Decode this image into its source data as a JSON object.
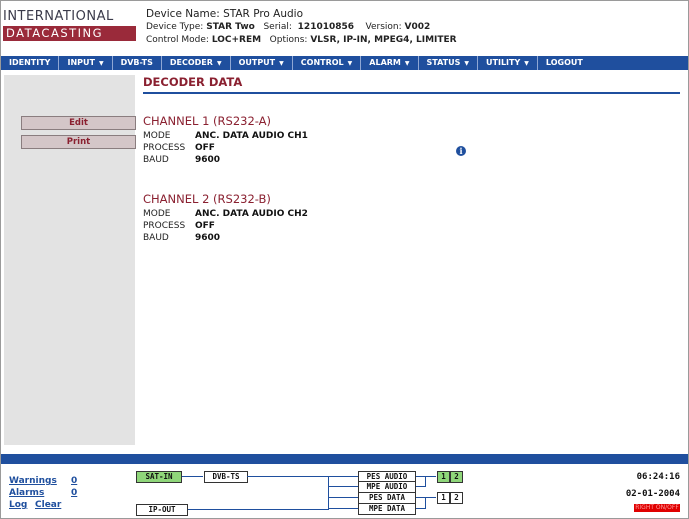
{
  "logo": {
    "line1": "INTERNATIONAL",
    "line2": "DATACASTING"
  },
  "device": {
    "name_label": "Device Name:",
    "name": "STAR Pro Audio",
    "type_label": "Device Type:",
    "type": "STAR Two",
    "serial_label": "Serial:",
    "serial": "121010856",
    "version_label": "Version:",
    "version": "V002",
    "control_label": "Control Mode:",
    "control": "LOC+REM",
    "options_label": "Options:",
    "options": "VLSR, IP-IN, MPEG4, LIMITER"
  },
  "nav": [
    {
      "label": "IDENTITY",
      "dropdown": false
    },
    {
      "label": "INPUT",
      "dropdown": true
    },
    {
      "label": "DVB-TS",
      "dropdown": false
    },
    {
      "label": "DECODER",
      "dropdown": true
    },
    {
      "label": "OUTPUT",
      "dropdown": true
    },
    {
      "label": "CONTROL",
      "dropdown": true
    },
    {
      "label": "ALARM",
      "dropdown": true
    },
    {
      "label": "STATUS",
      "dropdown": true
    },
    {
      "label": "UTILITY",
      "dropdown": true
    },
    {
      "label": "LOGOUT",
      "dropdown": false
    }
  ],
  "sidebar": {
    "edit_label": "Edit",
    "print_label": "Print"
  },
  "page_title": "DECODER DATA",
  "channels": [
    {
      "title": "CHANNEL 1 (RS232-A)",
      "mode_label": "MODE",
      "mode": "ANC. DATA AUDIO CH1",
      "process_label": "PROCESS",
      "process": "OFF",
      "baud_label": "BAUD",
      "baud": "9600"
    },
    {
      "title": "CHANNEL 2 (RS232-B)",
      "mode_label": "MODE",
      "mode": "ANC. DATA AUDIO CH2",
      "process_label": "PROCESS",
      "process": "OFF",
      "baud_label": "BAUD",
      "baud": "9600"
    }
  ],
  "info_icon": "i",
  "footer": {
    "warnings_label": "Warnings",
    "warnings": "0",
    "alarms_label": "Alarms",
    "alarms": "0",
    "log_label": "Log",
    "clear_label": "Clear",
    "time": "06:24:16",
    "date": "02-01-2004",
    "status_badge": "RIGHT ON/OFF"
  },
  "flow": {
    "sat_in": "SAT-IN",
    "dvb_ts": "DVB-TS",
    "ip_out": "IP-OUT",
    "pes_audio": "PES AUDIO",
    "mpe_audio": "MPE AUDIO",
    "pes_data": "PES DATA",
    "mpe_data": "MPE DATA",
    "audio_ch1": "1",
    "audio_ch2": "2",
    "data_ch1": "1",
    "data_ch2": "2"
  },
  "colors": {
    "nav_bg": "#1f4f9e",
    "accent_red": "#8a2030",
    "active_green": "#8fd67a"
  }
}
